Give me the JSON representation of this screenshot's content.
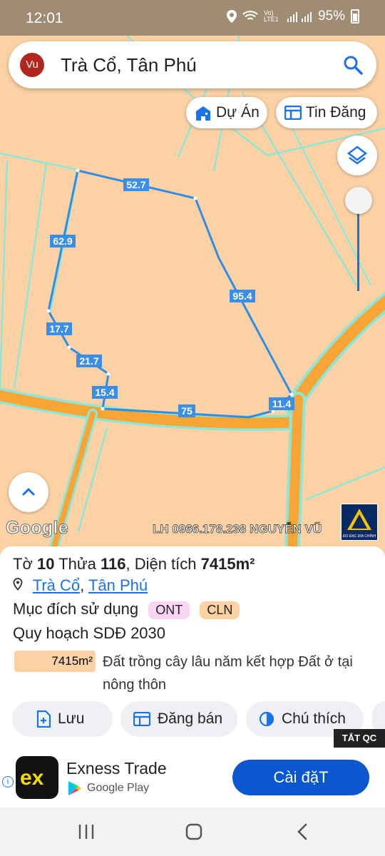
{
  "status_bar": {
    "time": "12:01",
    "network_label": "Vo) LTE1",
    "battery": "95%"
  },
  "search": {
    "avatar_text": "Vu",
    "query": "Trà Cổ, Tân Phú"
  },
  "map_chips": {
    "du_an": "Dự Án",
    "tin_dang": "Tin Đăng"
  },
  "map": {
    "segment_labels": [
      "52.7",
      "62.9",
      "95.4",
      "17.7",
      "21.7",
      "15.4",
      "11.4",
      "75"
    ],
    "google_logo": "Google",
    "watermark": "LH 0966.178.238 NGUYỄN VŨ",
    "badge_text": "ĐO ĐẠC ĐỊA CHÍNH",
    "polygon_color": "#2e8ee6",
    "road_color": "#f7a535",
    "boundary_color": "#8ee6d8"
  },
  "parcel": {
    "to_label": "Tờ",
    "to_value": "10",
    "thua_label": "Thửa",
    "thua_value": "116",
    "dien_tich_label": ", Diện tích",
    "area_value": "7415m²",
    "loc_commune": "Trà Cổ",
    "loc_sep": ",",
    "loc_district": "Tân Phú",
    "purpose_label": "Mục đích sử dụng",
    "tags": [
      "ONT",
      "CLN"
    ],
    "planning_label": "Quy hoạch SDĐ 2030",
    "area_box": "7415m²",
    "area_desc": "Đất trồng cây lâu năm kết hợp Đất ở tại nông thôn"
  },
  "actions": {
    "luu": "Lưu",
    "dang_ban": "Đăng bán",
    "chu_thich": "Chú thích"
  },
  "ad": {
    "label": "TẮT QC",
    "app_name": "Exness Trade",
    "store": "Google Play",
    "install": "Cài đặT",
    "icon_text": "ex",
    "info": "i"
  },
  "colors": {
    "accent": "#1a73e8",
    "install_button": "#0b57d0",
    "tag_ont": "#f9d4f5",
    "tag_cln": "#fcd1a4"
  }
}
